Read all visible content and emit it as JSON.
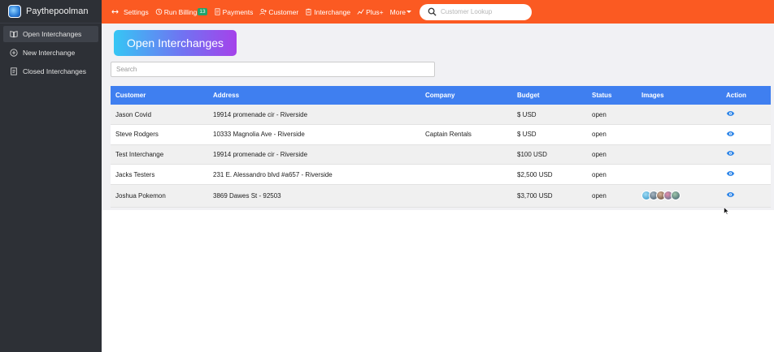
{
  "brand": {
    "name": "Paythepoolman"
  },
  "sidebar": {
    "items": [
      {
        "label": "Open Interchanges",
        "icon": "book-open-icon",
        "active": true
      },
      {
        "label": "New Interchange",
        "icon": "plus-circle-icon",
        "active": false
      },
      {
        "label": "Closed Interchanges",
        "icon": "document-icon",
        "active": false
      }
    ]
  },
  "topbar": {
    "items": [
      {
        "label": "Settings",
        "icon": "arrows-icon"
      },
      {
        "label": "Run Billing",
        "icon": "cycle-icon",
        "badge": "13"
      },
      {
        "label": "Payments",
        "icon": "receipt-icon"
      },
      {
        "label": "Customer",
        "icon": "user-plus-icon"
      },
      {
        "label": "Interchange",
        "icon": "clipboard-icon"
      },
      {
        "label": "Plus+",
        "icon": "chart-icon"
      },
      {
        "label": "More",
        "icon": "caret-icon"
      }
    ],
    "lookup_placeholder": "Customer Lookup"
  },
  "main": {
    "title": "Open Interchanges",
    "search_placeholder": "Search",
    "columns": [
      "Customer",
      "Address",
      "Company",
      "Budget",
      "Status",
      "Images",
      "Action"
    ],
    "rows": [
      {
        "customer": "Jason Covid",
        "address": "19914 promenade cir - Riverside",
        "company": "",
        "budget": "$ USD",
        "status": "open",
        "images": 0
      },
      {
        "customer": "Steve Rodgers",
        "address": "10333 Magnolia Ave - Riverside",
        "company": "Captain Rentals",
        "budget": "$ USD",
        "status": "open",
        "images": 0
      },
      {
        "customer": "Test Interchange",
        "address": "19914 promenade cir - Riverside",
        "company": "",
        "budget": "$100 USD",
        "status": "open",
        "images": 0
      },
      {
        "customer": "Jacks Testers",
        "address": "231 E. Alessandro blvd #a657 - Riverside",
        "company": "",
        "budget": "$2,500 USD",
        "status": "open",
        "images": 0
      },
      {
        "customer": "Joshua Pokemon",
        "address": "3869 Dawes St - 92503",
        "company": "",
        "budget": "$3,700 USD",
        "status": "open",
        "images": 5
      }
    ]
  },
  "colors": {
    "topbar": "#fb5a22",
    "sidebar": "#2d3036",
    "table_header": "#3f7ff0",
    "badge": "#20a36b",
    "action_icon": "#2f86e8"
  }
}
